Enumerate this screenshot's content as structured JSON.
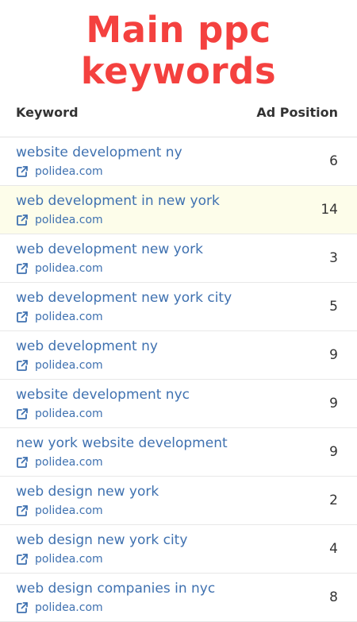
{
  "title": {
    "line1": "Main ppc",
    "line2": "keywords"
  },
  "table": {
    "headers": {
      "keyword": "Keyword",
      "position": "Ad Position"
    },
    "rows": [
      {
        "keyword": "website development ny",
        "domain": "polidea.com",
        "position": "6",
        "highlighted": false
      },
      {
        "keyword": "web development in new york",
        "domain": "polidea.com",
        "position": "14",
        "highlighted": true
      },
      {
        "keyword": "web development new york",
        "domain": "polidea.com",
        "position": "3",
        "highlighted": false
      },
      {
        "keyword": "web development new york city",
        "domain": "polidea.com",
        "position": "5",
        "highlighted": false
      },
      {
        "keyword": "web development ny",
        "domain": "polidea.com",
        "position": "9",
        "highlighted": false
      },
      {
        "keyword": "website development nyc",
        "domain": "polidea.com",
        "position": "9",
        "highlighted": false
      },
      {
        "keyword": "new york website development",
        "domain": "polidea.com",
        "position": "9",
        "highlighted": false
      },
      {
        "keyword": "web design new york",
        "domain": "polidea.com",
        "position": "2",
        "highlighted": false
      },
      {
        "keyword": "web design new york city",
        "domain": "polidea.com",
        "position": "4",
        "highlighted": false
      },
      {
        "keyword": "web design companies in nyc",
        "domain": "polidea.com",
        "position": "8",
        "highlighted": false
      }
    ]
  },
  "icons": {
    "domain_link": "external-link-icon"
  },
  "colors": {
    "title": "#f4413f",
    "link": "#3f71b0",
    "highlight_row": "#fdfdea",
    "text": "#333333"
  }
}
